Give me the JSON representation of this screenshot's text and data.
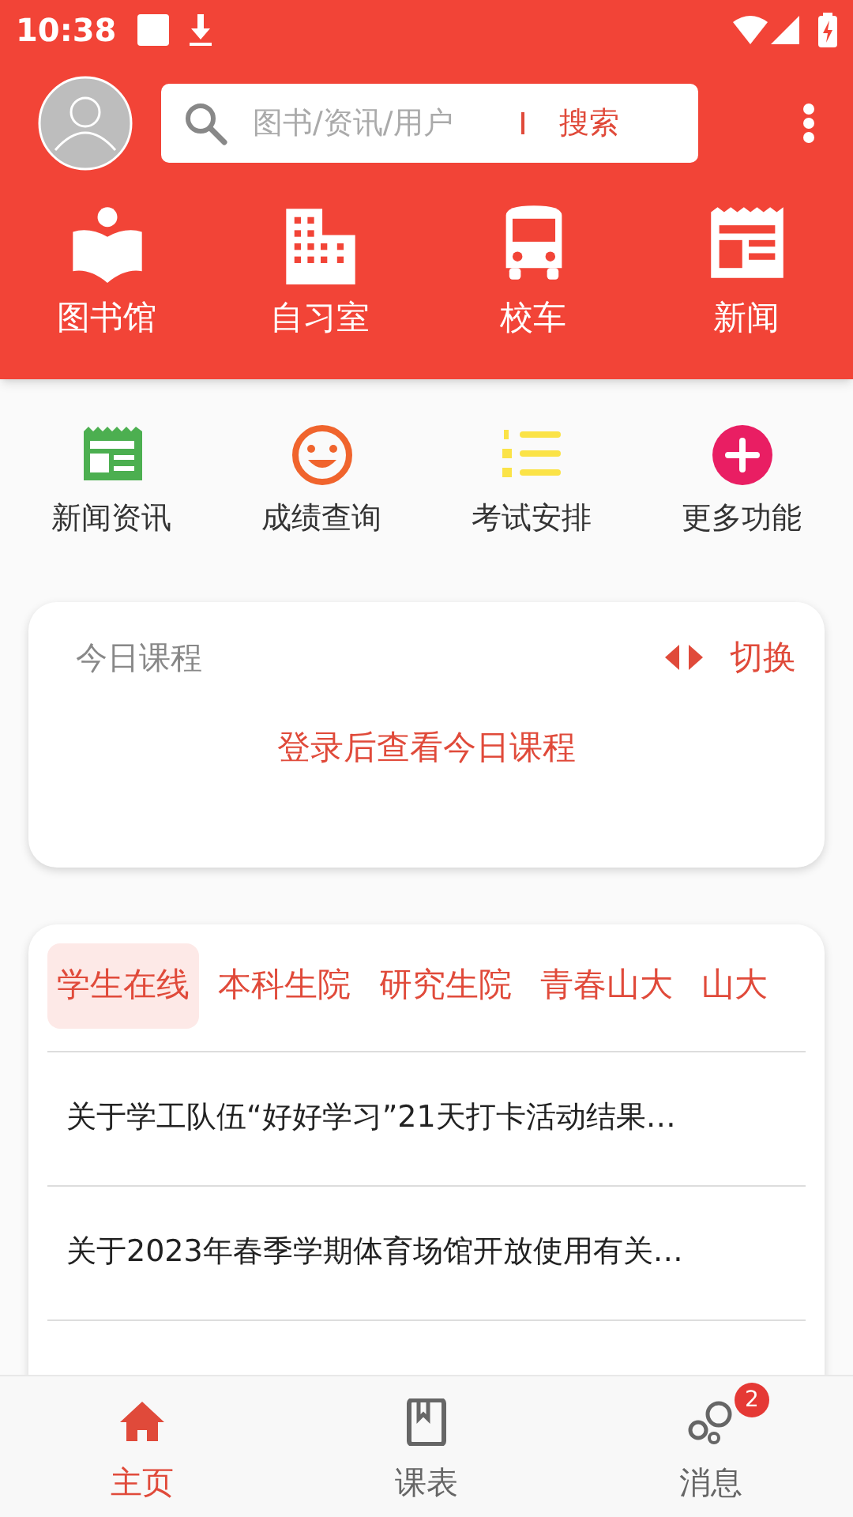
{
  "status_bar": {
    "time": "10:38"
  },
  "search": {
    "placeholder": "图书/资讯/用户",
    "button": "搜索"
  },
  "main_shortcuts": [
    {
      "kind": "library",
      "label": "图书馆"
    },
    {
      "kind": "building",
      "label": "自习室"
    },
    {
      "kind": "bus",
      "label": "校车"
    },
    {
      "kind": "news",
      "label": "新闻"
    }
  ],
  "functions": [
    {
      "kind": "news",
      "label": "新闻资讯",
      "color": "#4caf50"
    },
    {
      "kind": "smile",
      "label": "成绩查询",
      "color": "#f0642d"
    },
    {
      "kind": "list",
      "label": "考试安排",
      "color": "#fbe347"
    },
    {
      "kind": "plus",
      "label": "更多功能",
      "color": "#e91e63"
    }
  ],
  "today_course": {
    "title": "今日课程",
    "switch": "切换",
    "message": "登录后查看今日课程"
  },
  "news_tabs": [
    {
      "label": "学生在线",
      "selected": true
    },
    {
      "label": "本科生院",
      "selected": false
    },
    {
      "label": "研究生院",
      "selected": false
    },
    {
      "label": "青春山大",
      "selected": false
    },
    {
      "label": "山大",
      "selected": false
    }
  ],
  "news": [
    "关于学工队伍“好好学习”21天打卡活动结果…",
    "关于2023年春季学期体育场馆开放使用有关…"
  ],
  "bottom_nav": [
    {
      "kind": "home",
      "label": "主页",
      "selected": true
    },
    {
      "kind": "book",
      "label": "课表",
      "selected": false
    },
    {
      "kind": "bubbles",
      "label": "消息",
      "selected": false,
      "badge": "2"
    }
  ]
}
